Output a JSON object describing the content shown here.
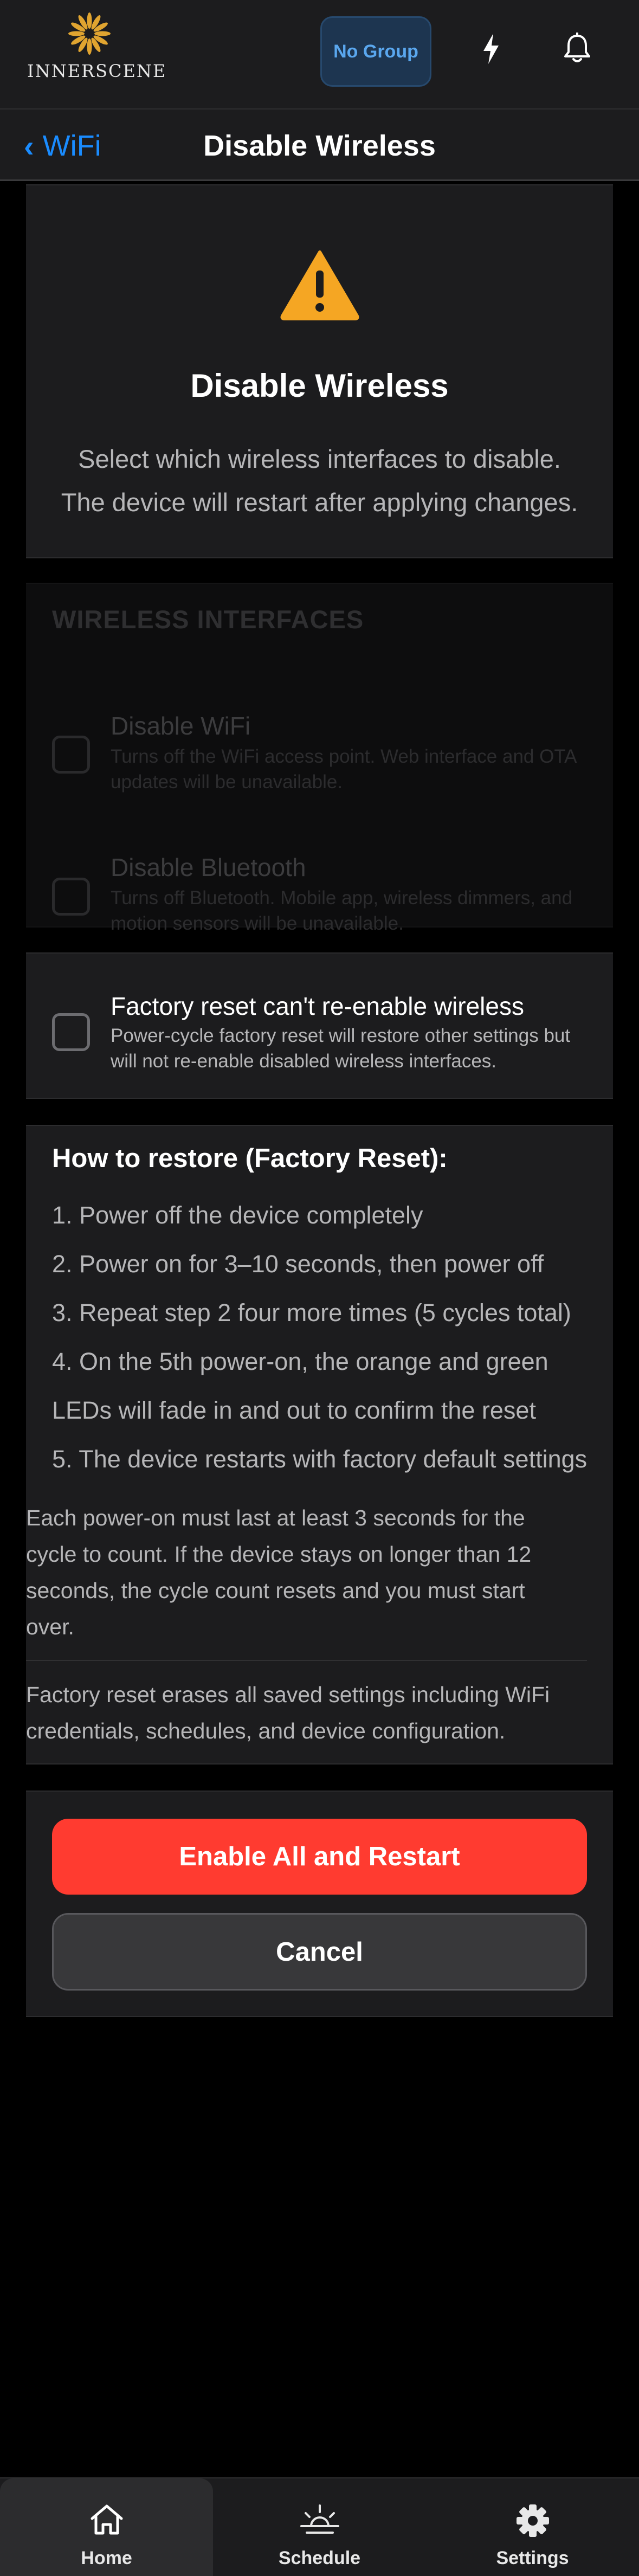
{
  "header": {
    "brand": "INNERSCENE",
    "group_button": "No Group"
  },
  "nav": {
    "back_label": "WiFi",
    "title": "Disable Wireless"
  },
  "warning": {
    "title": "Disable Wireless",
    "line1": "Select which wireless interfaces to disable.",
    "line2": "The device will restart after applying changes."
  },
  "interfaces": {
    "section_title": "WIRELESS INTERFACES",
    "options": [
      {
        "label": "Disable WiFi",
        "description": "Turns off the WiFi access point. Web interface and OTA updates will be unavailable.",
        "checked": false
      },
      {
        "label": "Disable Bluetooth",
        "description": "Turns off Bluetooth. Mobile app, wireless dimmers, and motion sensors will be unavailable.",
        "checked": false
      }
    ]
  },
  "factory_reset_option": {
    "label": "Factory reset can't re-enable wireless",
    "description": "Power-cycle factory reset will restore other settings but will not re-enable disabled wireless interfaces.",
    "checked": false
  },
  "howto": {
    "title": "How to restore (Factory Reset):",
    "steps": [
      "1. Power off the device completely",
      "2. Power on for 3–10 seconds, then power off",
      "3. Repeat step 2 four more times (5 cycles total)",
      "4. On the 5th power-on, the orange and green",
      "LEDs will fade in and out to confirm the reset",
      "5. The device restarts with factory default settings"
    ],
    "note": "Each power-on must last at least 3 seconds for the cycle to count. If the device stays on longer than 12 seconds, the cycle count resets and you must start over.",
    "warning": "Factory reset erases all saved settings including WiFi credentials, schedules, and device configuration."
  },
  "actions": {
    "primary": "Enable All and Restart",
    "secondary": "Cancel"
  },
  "tabs": [
    {
      "label": "Home",
      "icon": "home-icon",
      "active": true
    },
    {
      "label": "Schedule",
      "icon": "sunrise-icon",
      "active": false
    },
    {
      "label": "Settings",
      "icon": "gear-icon",
      "active": false
    }
  ],
  "colors": {
    "accent": "#1a8cff",
    "danger": "#ff3b30",
    "warning": "#f5a623",
    "logo_gold": "#e0a430"
  }
}
